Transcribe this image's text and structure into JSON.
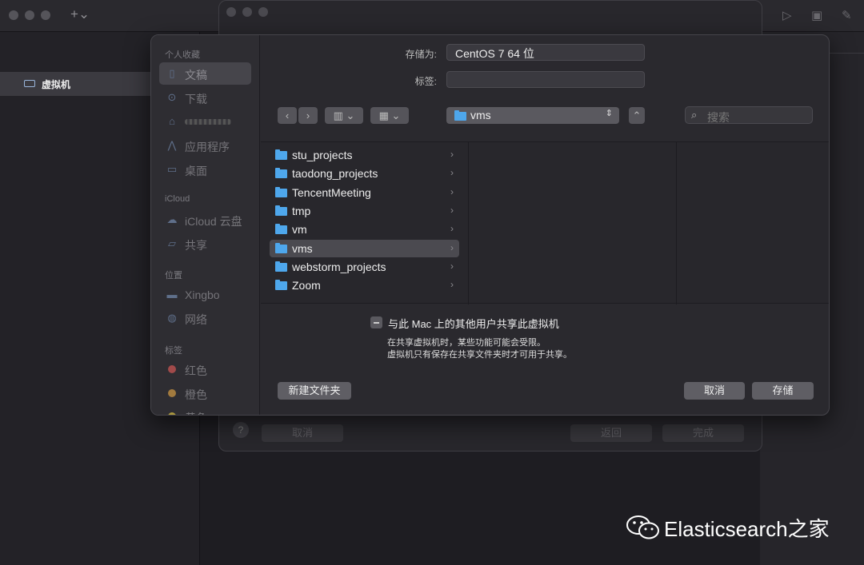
{
  "background_app": {
    "sidebar_item": "虚拟机",
    "behind_buttons": {
      "cancel": "取消",
      "back": "返回",
      "finish": "完成"
    },
    "help": "?"
  },
  "dialog": {
    "sidebar": {
      "sections": [
        {
          "title": "个人收藏",
          "items": [
            {
              "label": "文稿",
              "icon": "document-icon",
              "selected": true
            },
            {
              "label": "下载",
              "icon": "download-icon"
            },
            {
              "label": "",
              "icon": "home-icon"
            },
            {
              "label": "应用程序",
              "icon": "applications-icon"
            },
            {
              "label": "桌面",
              "icon": "desktop-icon"
            }
          ]
        },
        {
          "title": "iCloud",
          "items": [
            {
              "label": "iCloud 云盘",
              "icon": "cloud-icon"
            },
            {
              "label": "共享",
              "icon": "shared-folder-icon"
            }
          ]
        },
        {
          "title": "位置",
          "items": [
            {
              "label": "Xingbo",
              "icon": "disk-icon"
            },
            {
              "label": "网络",
              "icon": "network-icon"
            }
          ]
        },
        {
          "title": "标签",
          "items": [
            {
              "label": "红色",
              "icon": "tag-dot",
              "color": "#a14a4a"
            },
            {
              "label": "橙色",
              "icon": "tag-dot",
              "color": "#a27a3e"
            },
            {
              "label": "黄色",
              "icon": "tag-dot",
              "color": "#a8963d"
            }
          ]
        }
      ]
    },
    "save_as_label": "存储为:",
    "save_as_value": "CentOS 7 64 位",
    "tags_label": "标签:",
    "tags_value": "",
    "path": "vms",
    "search_placeholder": "搜索",
    "files": [
      {
        "name": "stu_projects"
      },
      {
        "name": "taodong_projects"
      },
      {
        "name": "TencentMeeting"
      },
      {
        "name": "tmp"
      },
      {
        "name": "vm"
      },
      {
        "name": "vms",
        "selected": true
      },
      {
        "name": "webstorm_projects"
      },
      {
        "name": "Zoom"
      }
    ],
    "share_checkbox_label": "与此 Mac 上的其他用户共享此虚拟机",
    "share_note_1": "在共享虚拟机时，某些功能可能会受限。",
    "share_note_2": "虚拟机只有保存在共享文件夹时才可用于共享。",
    "new_folder_button": "新建文件夹",
    "cancel_button": "取消",
    "save_button": "存储"
  },
  "watermark": "Elasticsearch之家"
}
